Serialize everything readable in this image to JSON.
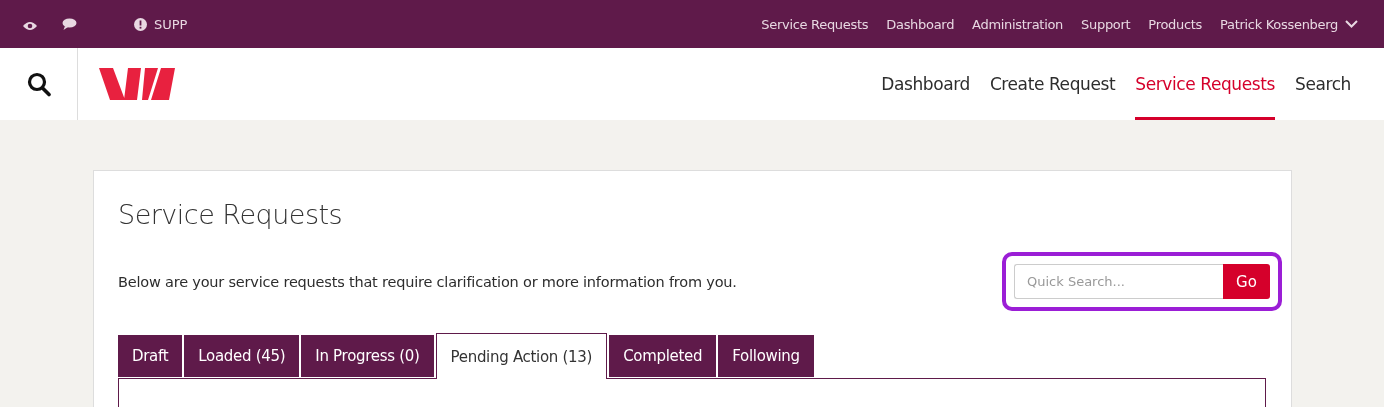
{
  "top_bar": {
    "alert_label": "SUPP",
    "links": [
      "Service Requests",
      "Dashboard",
      "Administration",
      "Support",
      "Products"
    ],
    "user": "Patrick Kossenberg"
  },
  "main_nav": [
    {
      "label": "Dashboard",
      "selected": false
    },
    {
      "label": "Create Request",
      "selected": false
    },
    {
      "label": "Service Requests",
      "selected": true
    },
    {
      "label": "Search",
      "selected": false
    }
  ],
  "page": {
    "title": "Service Requests",
    "description": "Below are your service requests that require clarification or more information from you.",
    "quick_search": {
      "placeholder": "Quick Search...",
      "button": "Go",
      "highlighted": true
    },
    "tabs": [
      {
        "label": "Draft",
        "selected": false
      },
      {
        "label": "Loaded (45)",
        "selected": false
      },
      {
        "label": "In Progress (0)",
        "selected": false
      },
      {
        "label": "Pending Action (13)",
        "selected": true
      },
      {
        "label": "Completed",
        "selected": false
      },
      {
        "label": "Following",
        "selected": false
      }
    ]
  }
}
